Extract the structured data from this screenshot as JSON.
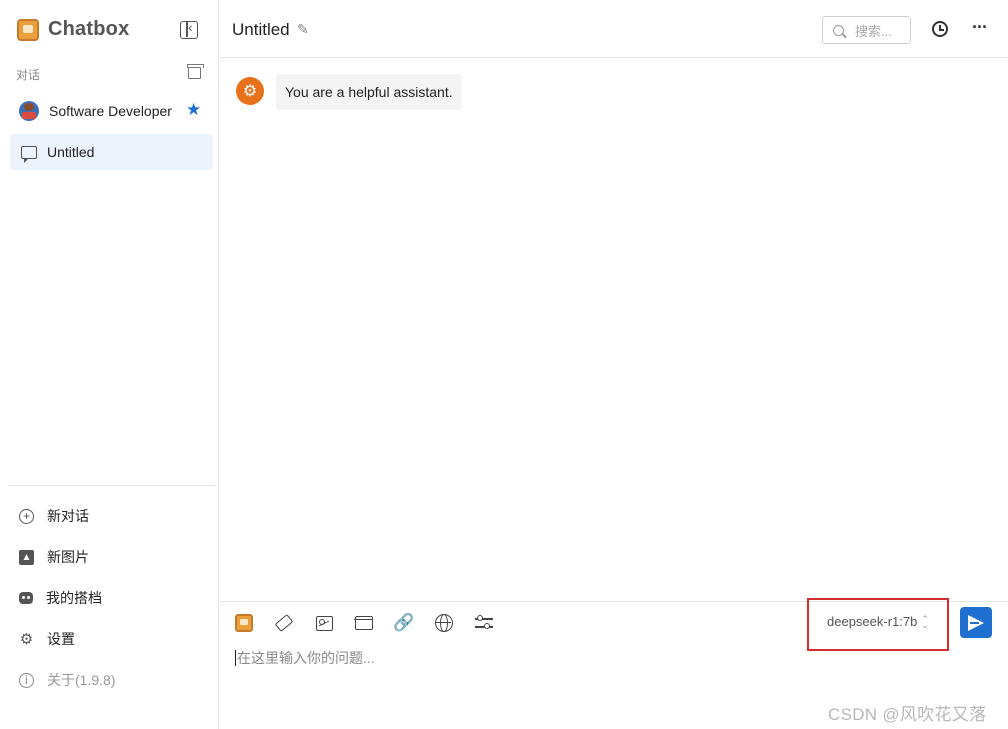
{
  "app": {
    "name": "Chatbox"
  },
  "sidebar": {
    "section_label": "对话",
    "conversations": [
      {
        "label": "Software Developer",
        "starred": true,
        "icon": "developer-avatar"
      },
      {
        "label": "Untitled",
        "active": true,
        "icon": "chat-bubble-icon"
      }
    ],
    "menu": [
      {
        "label": "新对话",
        "icon": "plus-circle-icon"
      },
      {
        "label": "新图片",
        "icon": "image-plus-icon"
      },
      {
        "label": "我的搭档",
        "icon": "robot-icon"
      },
      {
        "label": "设置",
        "icon": "gear-icon"
      },
      {
        "label": "关于(1.9.8)",
        "icon": "info-icon"
      }
    ]
  },
  "header": {
    "title": "Untitled",
    "search_placeholder": "搜索..."
  },
  "messages": [
    {
      "role": "system",
      "text": "You are a helpful assistant."
    }
  ],
  "composer": {
    "model": "deepseek-r1:7b",
    "placeholder": "在这里输入你的问题...",
    "tools": [
      "chatbox-logo-icon",
      "eraser-icon",
      "image-icon",
      "folder-icon",
      "link-icon",
      "globe-icon",
      "settings-sliders-icon"
    ]
  },
  "colors": {
    "accent": "#1f6fd1",
    "system_avatar": "#e8711b",
    "highlight_box": "#d32f2f",
    "active_item_bg": "#ecf3fd"
  },
  "watermark": "CSDN @风吹花又落"
}
